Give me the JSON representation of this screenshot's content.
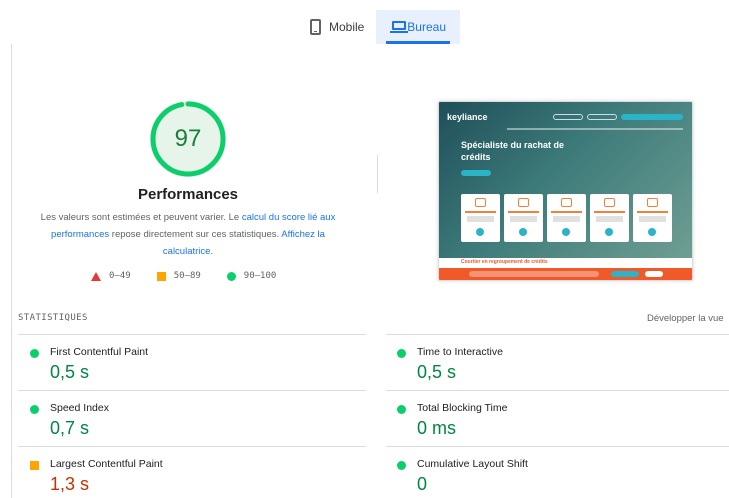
{
  "tabs": [
    {
      "label": "Mobile",
      "icon": "phone-icon",
      "selected": false
    },
    {
      "label": "Bureau",
      "icon": "laptop-icon",
      "selected": true
    }
  ],
  "score": {
    "value": "97",
    "fraction": 0.97,
    "color": "#0cce6b",
    "title": "Performances",
    "desc_prefix": "Les valeurs sont estimées et peuvent varier. Le ",
    "desc_link1": "calcul du score lié aux performances",
    "desc_middle": " repose directement sur ces statistiques. ",
    "desc_link2": "Affichez la calculatrice",
    "desc_suffix": "."
  },
  "legend": [
    {
      "label": "0–49",
      "shape": "triangle",
      "color": "#e53935"
    },
    {
      "label": "50–89",
      "shape": "square",
      "color": "#ffa400"
    },
    {
      "label": "90–100",
      "shape": "circle",
      "color": "#0cce6b"
    }
  ],
  "thumbnail": {
    "logo": "keyliance",
    "headline": "Spécialiste du rachat de crédits",
    "band": "Courtier en regroupement de crédits"
  },
  "stats": {
    "title": "STATISTIQUES",
    "expand": "Développer la vue",
    "metrics": [
      {
        "label": "First Contentful Paint",
        "value": "0,5 s",
        "status": "good"
      },
      {
        "label": "Time to Interactive",
        "value": "0,5 s",
        "status": "good"
      },
      {
        "label": "Speed Index",
        "value": "0,7 s",
        "status": "good"
      },
      {
        "label": "Total Blocking Time",
        "value": "0 ms",
        "status": "good"
      },
      {
        "label": "Largest Contentful Paint",
        "value": "1,3 s",
        "status": "average"
      },
      {
        "label": "Cumulative Layout Shift",
        "value": "0",
        "status": "good"
      }
    ]
  }
}
